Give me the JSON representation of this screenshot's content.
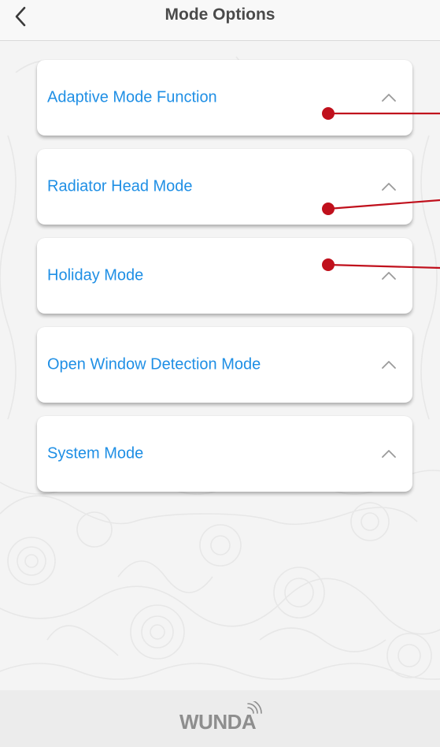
{
  "header": {
    "title": "Mode Options",
    "back_icon": "chevron-left-icon"
  },
  "modes": [
    {
      "label": "Adaptive Mode Function",
      "icon": "chevron-up-icon"
    },
    {
      "label": "Radiator Head Mode",
      "icon": "chevron-up-icon"
    },
    {
      "label": "Holiday Mode",
      "icon": "chevron-up-icon"
    },
    {
      "label": "Open Window Detection Mode",
      "icon": "chevron-up-icon"
    },
    {
      "label": "System Mode",
      "icon": "chevron-up-icon"
    }
  ],
  "footer": {
    "logo_text": "WUNDA",
    "logo_icon": "wifi-signal-icon"
  },
  "colors": {
    "accent": "#1f8fe5",
    "title": "#4a4a4a",
    "annotation": "#c0101c",
    "footer_bg": "#ececec",
    "logo": "#8e8e8e"
  }
}
